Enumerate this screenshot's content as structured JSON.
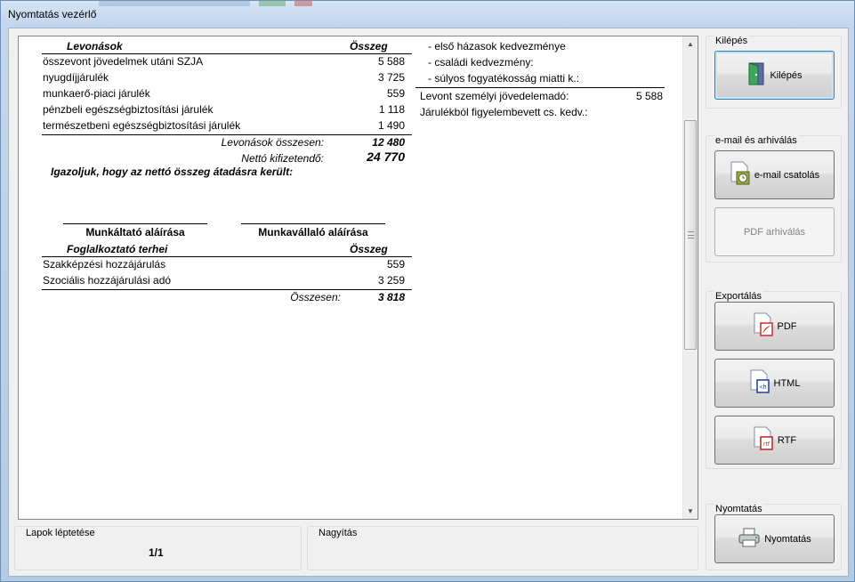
{
  "window": {
    "title": "Nyomtatás vezérlő"
  },
  "report": {
    "deductions": {
      "header_label": "Levonások",
      "header_amount": "Összeg",
      "rows": [
        {
          "label": "összevont jövedelmek utáni SZJA",
          "amount": "5 588"
        },
        {
          "label": "nyugdíjjárulék",
          "amount": "3 725"
        },
        {
          "label": "munkaerő-piaci járulék",
          "amount": "559"
        },
        {
          "label": "pénzbeli egészségbiztosítási járulék",
          "amount": "1 118"
        },
        {
          "label": "természetbeni egészségbiztosítási járulék",
          "amount": "1 490"
        }
      ],
      "total_label": "Levonások összesen:",
      "total_amount": "12 480",
      "net_label": "Nettó kifizetendő:",
      "net_amount": "24 770"
    },
    "certify_text": "Igazoljuk, hogy az nettó összeg átadásra került:",
    "signatures": {
      "employer": "Munkáltató aláírása",
      "employee": "Munkavállaló aláírása"
    },
    "employer_costs": {
      "header_label": "Foglalkoztató terhei",
      "header_amount": "Összeg",
      "rows": [
        {
          "label": "Szakképzési hozzájárulás",
          "amount": "559"
        },
        {
          "label": "Szociális hozzájárulási adó",
          "amount": "3 259"
        }
      ],
      "total_label": "Összesen:",
      "total_amount": "3 818"
    },
    "right_column": {
      "items": [
        "- első házasok kedvezménye",
        "- családi kedvezmény:",
        "- súlyos fogyatékosság miatti k.:"
      ],
      "withheld_label": "Levont személyi jövedelemadó:",
      "withheld_amount": "5 588",
      "contrib_label": "Járulékból figyelembevett cs. kedv.:"
    }
  },
  "groups": {
    "exit": {
      "title": "Kilépés",
      "button": "Kilépés"
    },
    "email": {
      "title": "e-mail és arhiválás",
      "email_button": "e-mail csatolás",
      "pdf_archive_button": "PDF arhiválás"
    },
    "export": {
      "title": "Exportálás",
      "pdf": "PDF",
      "html": "HTML",
      "rtf": "RTF"
    },
    "print": {
      "title": "Nyomtatás",
      "button": "Nyomtatás"
    }
  },
  "status": {
    "paging_title": "Lapok léptetése",
    "paging_value": "1/1",
    "zoom_title": "Nagyítás"
  },
  "icons": {
    "exit": "door-exit-icon",
    "email": "email-attach-icon",
    "pdf": "pdf-file-icon",
    "html": "html-file-icon",
    "rtf": "rtf-file-icon",
    "print": "printer-icon"
  },
  "colors": {
    "pdf_red": "#d12a2a",
    "html_blue": "#1f3f96",
    "rtf_red": "#c02020"
  }
}
